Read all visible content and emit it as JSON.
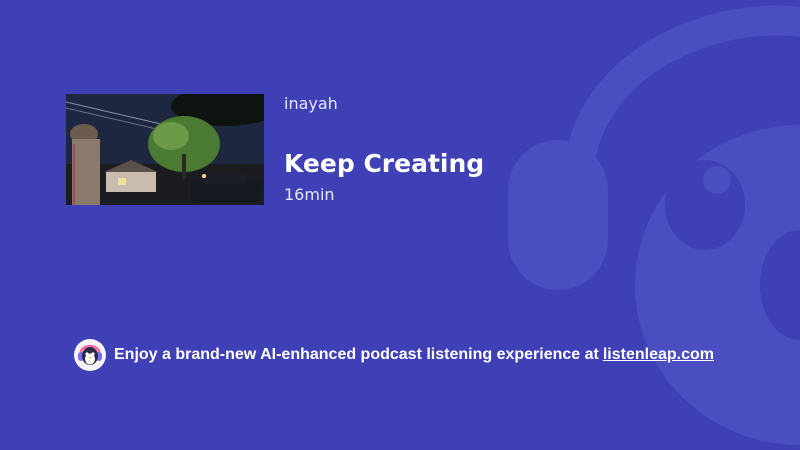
{
  "episode": {
    "author": "inayah",
    "title": "Keep Creating",
    "duration": "16min"
  },
  "cover": {
    "description": "night photo of a street with a tree and houses",
    "icon": "cover-image"
  },
  "promo": {
    "text": "Enjoy a brand-new AI-enhanced podcast listening experience at",
    "link_text": "listenleap.com",
    "logo_icon": "penguin-headphones-icon"
  },
  "colors": {
    "background": "#3f3fb6",
    "watermark": "#4b4fbf",
    "text_primary": "#ffffff",
    "text_secondary": "#e6e8ff"
  }
}
